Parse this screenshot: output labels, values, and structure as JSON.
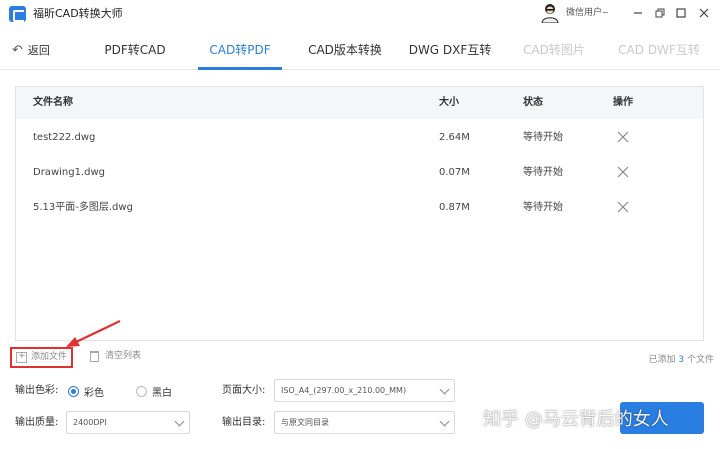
{
  "app": {
    "title": "福昕CAD转换大师",
    "user_name": "微信用户",
    "user_caret": "~",
    "window_controls": [
      "minimize-icon",
      "restore-icon",
      "maximize-icon",
      "close-icon"
    ]
  },
  "nav": {
    "back_label": "返回",
    "tabs": [
      {
        "label": "PDF转CAD",
        "state": "normal"
      },
      {
        "label": "CAD转PDF",
        "state": "active"
      },
      {
        "label": "CAD版本转换",
        "state": "normal"
      },
      {
        "label": "DWG DXF互转",
        "state": "normal"
      },
      {
        "label": "CAD转图片",
        "state": "disabled"
      },
      {
        "label": "CAD DWF互转",
        "state": "disabled"
      }
    ]
  },
  "table": {
    "headers": {
      "name": "文件名称",
      "size": "大小",
      "status": "状态",
      "action": "操作"
    },
    "rows": [
      {
        "name": "test222.dwg",
        "size": "2.64M",
        "status": "等待开始"
      },
      {
        "name": "Drawing1.dwg",
        "size": "0.07M",
        "status": "等待开始"
      },
      {
        "name": "5.13平面-多图层.dwg",
        "size": "0.87M",
        "status": "等待开始"
      }
    ]
  },
  "toolbar": {
    "add_file_label": "添加文件",
    "clear_list_label": "清空列表",
    "count_prefix": "已添加",
    "count_value": "3",
    "count_suffix": "个文件"
  },
  "settings": {
    "color_label": "输出色彩:",
    "color_options": [
      "彩色",
      "黑白"
    ],
    "color_selected": "彩色",
    "page_size_label": "页面大小:",
    "page_size_value": "ISO_A4_(297.00_x_210.00_MM)",
    "quality_label": "输出质量:",
    "quality_value": "2400DPI",
    "output_dir_label": "输出目录:",
    "output_dir_value": "与原文同目录"
  },
  "watermark": "知乎 @马云背后的女人",
  "colors": {
    "accent": "#2a7de1",
    "highlight": "#e03030"
  }
}
